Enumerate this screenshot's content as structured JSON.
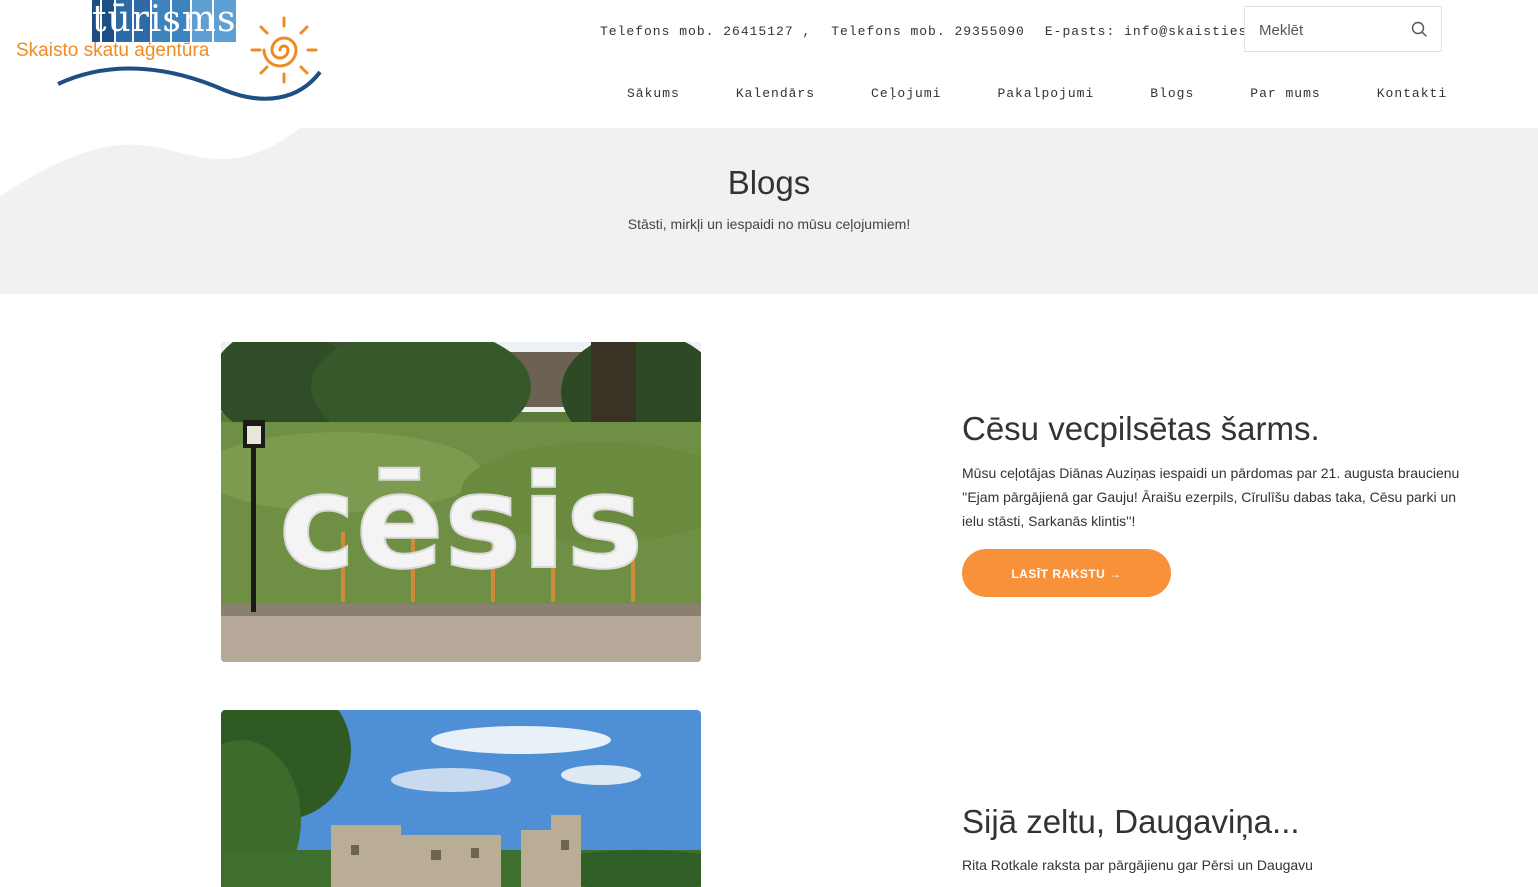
{
  "logo": {
    "brand": "tūrisms",
    "tagline": "Skaisto skatu aģentūra"
  },
  "contacts": {
    "phone1": "Telefons mob. 26415127 ,",
    "phone2": "Telefons mob. 29355090",
    "email": "E-pasts: info@skaistieskati.lv"
  },
  "search": {
    "placeholder": "Meklēt"
  },
  "nav": {
    "items": [
      "Sākums",
      "Kalendārs",
      "Ceļojumi",
      "Pakalpojumi",
      "Blogs",
      "Par mums",
      "Kontakti"
    ]
  },
  "banner": {
    "title": "Blogs",
    "subtitle": "Stāsti, mirkļi un iespaidi no mūsu ceļojumiem!"
  },
  "posts": [
    {
      "image_text": "cēsis",
      "title": "Cēsu vecpilsētas šarms.",
      "excerpt": "Mūsu ceļotājas Diānas Auziņas iespaidi un pārdomas par 21. augusta braucienu ''Ejam pārgājienā gar Gauju! Āraišu ezerpils, Cīrulīšu dabas taka, Cēsu parki un ielu stāsti, Sarkanās klintis''!",
      "button": "LASĪT RAKSTU →"
    },
    {
      "title": "Sijā zeltu, Daugaviņa...",
      "excerpt": "Rita Rotkale raksta par pārgājienu gar Pērsi un Daugavu"
    }
  ],
  "colors": {
    "accent": "#f7923a",
    "logo_orange": "#f08a24",
    "logo_blue": "#1d4f84",
    "banner_bg": "#f1f1f1"
  }
}
